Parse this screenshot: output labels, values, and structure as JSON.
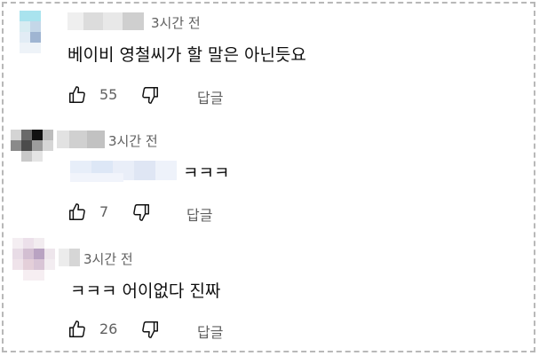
{
  "comments": [
    {
      "timestamp": "3시간 전",
      "text": "베이비 영철씨가 할 말은 아닌듯요",
      "likes": "55",
      "reply_label": "답글"
    },
    {
      "timestamp": "3시간 전",
      "text_suffix": "ㅋㅋㅋ",
      "likes": "7",
      "reply_label": "답글"
    },
    {
      "timestamp": "3시간 전",
      "text": "ㅋㅋㅋ 어이없다 진짜",
      "likes": "26",
      "reply_label": "답글"
    }
  ],
  "icons": {
    "like": "thumbs-up-icon",
    "dislike": "thumbs-down-icon"
  }
}
